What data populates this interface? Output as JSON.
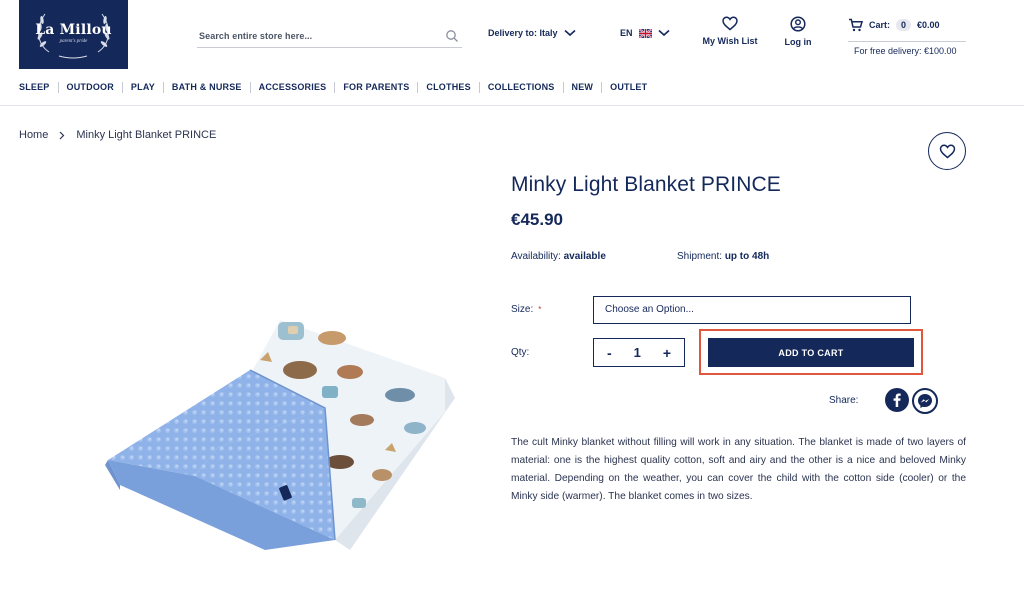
{
  "logo": {
    "name": "La Millou",
    "tagline": "parent's pride"
  },
  "search": {
    "placeholder": "Search entire store here..."
  },
  "delivery": {
    "label": "Delivery to: Italy"
  },
  "language": {
    "code": "EN"
  },
  "header": {
    "wishlist_label": "My Wish List",
    "login_label": "Log in"
  },
  "cart": {
    "label": "Cart:",
    "count": "0",
    "total": "€0.00",
    "free_delivery": "For free delivery: €100.00"
  },
  "nav": {
    "items": [
      "SLEEP",
      "OUTDOOR",
      "PLAY",
      "BATH & NURSE",
      "ACCESSORIES",
      "FOR PARENTS",
      "CLOTHES",
      "COLLECTIONS",
      "NEW",
      "OUTLET"
    ]
  },
  "breadcrumb": {
    "home": "Home",
    "current": "Minky Light Blanket PRINCE"
  },
  "product": {
    "title": "Minky Light Blanket PRINCE",
    "price": "€45.90",
    "availability_label": "Availability:",
    "availability_value": "available",
    "shipment_label": "Shipment:",
    "shipment_value": "up to 48h",
    "size_label": "Size:",
    "size_required": "*",
    "size_placeholder": "Choose an Option...",
    "qty_label": "Qty:",
    "qty_minus": "-",
    "qty_value": "1",
    "qty_plus": "+",
    "add_to_cart": "ADD TO CART",
    "share_label": "Share:",
    "description": "The cult Minky blanket without filling will work in any situation. The blanket is made of two layers of material: one is the highest quality cotton, soft and airy and the other is a nice and beloved Minky material. Depending on the weather, you can cover the child with the cotton side (cooler) or the Minky side (warmer). The blanket comes in two sizes."
  },
  "colors": {
    "brand_navy": "#14285a",
    "highlight": "#e0573e",
    "minky_blue": "#8fb3e8"
  }
}
